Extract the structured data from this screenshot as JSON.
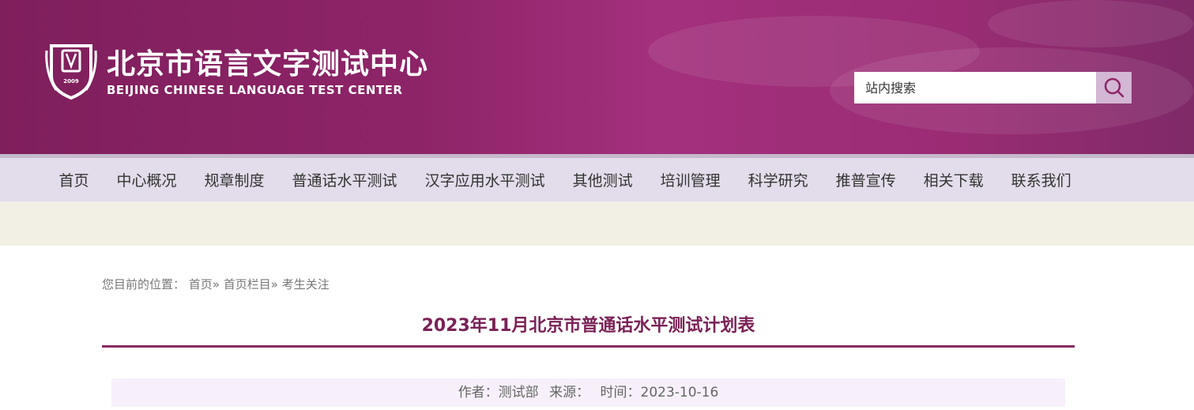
{
  "header": {
    "logo_cn": "北京市语言文字测试中心",
    "logo_en": "BEIJING CHINESE LANGUAGE TEST CENTER",
    "emblem_year": "2009",
    "search_placeholder": "站内搜索",
    "search_icon": "search-icon"
  },
  "nav": {
    "items": [
      "首页",
      "中心概况",
      "规章制度",
      "普通话水平测试",
      "汉字应用水平测试",
      "其他测试",
      "培训管理",
      "科学研究",
      "推普宣传",
      "相关下载",
      "联系我们"
    ]
  },
  "breadcrumb": {
    "prefix": "您目前的位置：",
    "items": [
      "首页",
      "首页栏目",
      "考生关注"
    ],
    "separator": "»"
  },
  "article": {
    "title": "2023年11月北京市普通话水平测试计划表",
    "author_label": "作者：测试部",
    "source_label": "来源：",
    "time_label": "时间：2023-10-16"
  },
  "colors": {
    "brand": "#8e2468",
    "title": "#7b2256",
    "nav_bg": "#e3dcea",
    "band_bg": "#f2efe5",
    "meta_bg": "#f7f0fb",
    "search_btn": "#d3b7d4"
  }
}
